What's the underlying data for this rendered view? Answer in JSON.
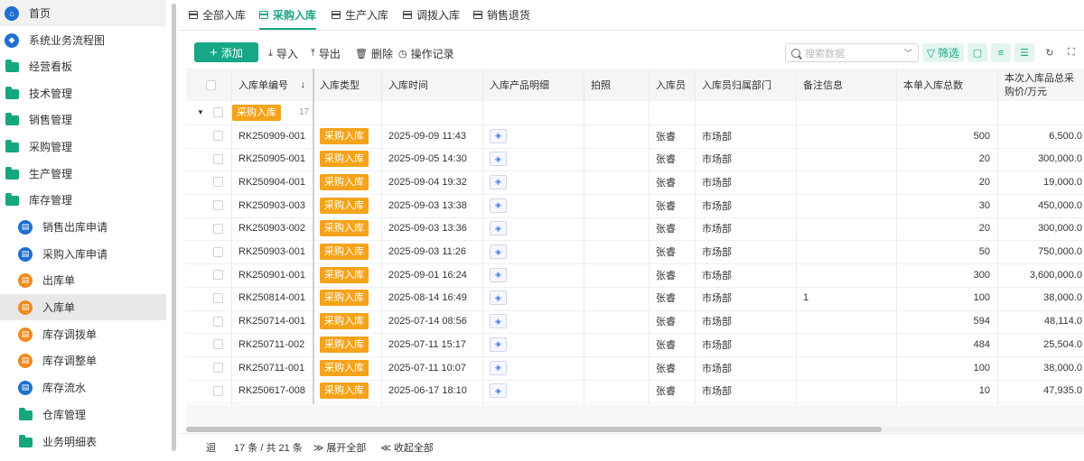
{
  "sidebar": {
    "items": [
      {
        "label": "首页",
        "icon": "home-icon",
        "level": 1
      },
      {
        "label": "系统业务流程图",
        "icon": "flow-icon",
        "level": 1
      },
      {
        "label": "经营看板",
        "icon": "folder-icon",
        "level": 1
      },
      {
        "label": "技术管理",
        "icon": "folder-icon",
        "level": 1
      },
      {
        "label": "销售管理",
        "icon": "folder-icon",
        "level": 1
      },
      {
        "label": "采购管理",
        "icon": "folder-icon",
        "level": 1
      },
      {
        "label": "生产管理",
        "icon": "folder-icon",
        "level": 1
      },
      {
        "label": "库存管理",
        "icon": "folder-open-icon",
        "level": 1
      },
      {
        "label": "销售出库申请",
        "icon": "doc-icon",
        "level": 2
      },
      {
        "label": "采购入库申请",
        "icon": "doc-icon",
        "level": 2
      },
      {
        "label": "出库单",
        "icon": "form-icon",
        "level": 2
      },
      {
        "label": "入库单",
        "icon": "form-icon",
        "level": 2
      },
      {
        "label": "库存调拨单",
        "icon": "form-icon",
        "level": 2
      },
      {
        "label": "库存调整单",
        "icon": "form-icon",
        "level": 2
      },
      {
        "label": "库存流水",
        "icon": "doc-icon",
        "level": 2
      },
      {
        "label": "仓库管理",
        "icon": "folder-icon",
        "level": 2
      },
      {
        "label": "业务明细表",
        "icon": "folder-icon",
        "level": 2
      }
    ]
  },
  "tabs": [
    "全部入库",
    "采购入库",
    "生产入库",
    "调拨入库",
    "销售退货"
  ],
  "active_tab": "采购入库",
  "toolbar": {
    "add": "添加",
    "import": "导入",
    "export": "导出",
    "delete": "删除",
    "log": "操作记录",
    "search_placeholder": "搜索数据",
    "filter": "筛选"
  },
  "table": {
    "columns": [
      "入库单编号",
      "入库类型",
      "入库时间",
      "入库产品明细",
      "拍照",
      "入库员",
      "入库员归属部门",
      "备注信息",
      "本单入库总数",
      "本次入库品总采购价/万元"
    ],
    "group": {
      "label": "采购入库",
      "count": "17"
    },
    "rows": [
      {
        "id": "RK250909-001",
        "type": "采购入库",
        "time": "2025-09-09 11:43",
        "staff": "张睿",
        "dept": "市场部",
        "note": "",
        "qty": "500",
        "price": "6,500.0"
      },
      {
        "id": "RK250905-001",
        "type": "采购入库",
        "time": "2025-09-05 14:30",
        "staff": "张睿",
        "dept": "市场部",
        "note": "",
        "qty": "20",
        "price": "300,000.0"
      },
      {
        "id": "RK250904-001",
        "type": "采购入库",
        "time": "2025-09-04 19:32",
        "staff": "张睿",
        "dept": "市场部",
        "note": "",
        "qty": "20",
        "price": "19,000.0"
      },
      {
        "id": "RK250903-003",
        "type": "采购入库",
        "time": "2025-09-03 13:38",
        "staff": "张睿",
        "dept": "市场部",
        "note": "",
        "qty": "30",
        "price": "450,000.0"
      },
      {
        "id": "RK250903-002",
        "type": "采购入库",
        "time": "2025-09-03 13:36",
        "staff": "张睿",
        "dept": "市场部",
        "note": "",
        "qty": "20",
        "price": "300,000.0"
      },
      {
        "id": "RK250903-001",
        "type": "采购入库",
        "time": "2025-09-03 11:26",
        "staff": "张睿",
        "dept": "市场部",
        "note": "",
        "qty": "50",
        "price": "750,000.0"
      },
      {
        "id": "RK250901-001",
        "type": "采购入库",
        "time": "2025-09-01 16:24",
        "staff": "张睿",
        "dept": "市场部",
        "note": "",
        "qty": "300",
        "price": "3,600,000.0"
      },
      {
        "id": "RK250814-001",
        "type": "采购入库",
        "time": "2025-08-14 16:49",
        "staff": "张睿",
        "dept": "市场部",
        "note": "1",
        "qty": "100",
        "price": "38,000.0"
      },
      {
        "id": "RK250714-001",
        "type": "采购入库",
        "time": "2025-07-14 08:56",
        "staff": "张睿",
        "dept": "市场部",
        "note": "",
        "qty": "594",
        "price": "48,114.0"
      },
      {
        "id": "RK250711-002",
        "type": "采购入库",
        "time": "2025-07-11 15:17",
        "staff": "张睿",
        "dept": "市场部",
        "note": "",
        "qty": "484",
        "price": "25,504.0"
      },
      {
        "id": "RK250711-001",
        "type": "采购入库",
        "time": "2025-07-11 10:07",
        "staff": "张睿",
        "dept": "市场部",
        "note": "",
        "qty": "100",
        "price": "38,000.0"
      },
      {
        "id": "RK250617-008",
        "type": "采购入库",
        "time": "2025-06-17 18:10",
        "staff": "张睿",
        "dept": "市场部",
        "note": "",
        "qty": "10",
        "price": "47,935.0"
      }
    ]
  },
  "footer": {
    "count": "17 条 / 共 21 条",
    "expand_all": "展开全部",
    "collapse_all": "收起全部"
  },
  "colors": {
    "accent": "#17a686",
    "tag": "#f5a31a",
    "blue_icon": "#1f6fd1",
    "orange_icon": "#f08a1e"
  }
}
